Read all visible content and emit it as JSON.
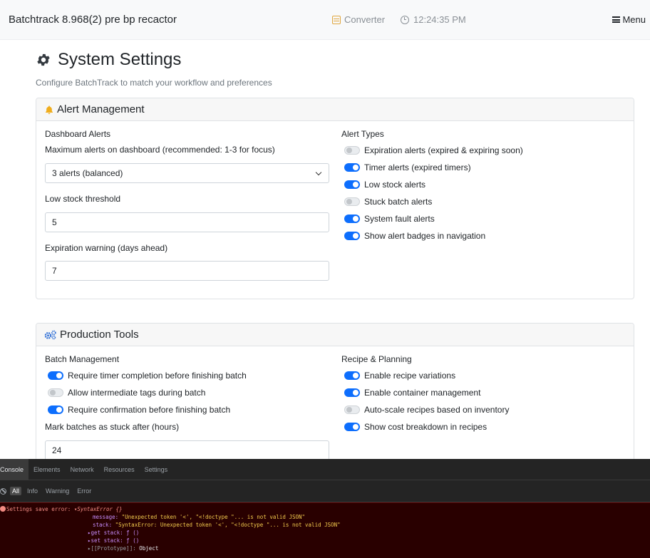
{
  "navbar": {
    "brand": "Batchtrack 8.968(2) pre bp recactor",
    "converter": "Converter",
    "time": "12:24:35 PM",
    "menu": "Menu"
  },
  "page": {
    "title": "System Settings",
    "subtitle": "Configure BatchTrack to match your workflow and preferences"
  },
  "alert_card": {
    "title": "Alert Management",
    "dashboard_heading": "Dashboard Alerts",
    "max_alerts_label": "Maximum alerts on dashboard (recommended: 1-3 for focus)",
    "max_alerts_value": "3 alerts (balanced)",
    "low_stock_label": "Low stock threshold",
    "low_stock_value": "5",
    "expiration_label": "Expiration warning (days ahead)",
    "expiration_value": "7",
    "types_heading": "Alert Types",
    "toggles": [
      {
        "label": "Expiration alerts (expired & expiring soon)",
        "on": false
      },
      {
        "label": "Timer alerts (expired timers)",
        "on": true
      },
      {
        "label": "Low stock alerts",
        "on": true
      },
      {
        "label": "Stuck batch alerts",
        "on": false
      },
      {
        "label": "System fault alerts",
        "on": true
      },
      {
        "label": "Show alert badges in navigation",
        "on": true
      }
    ]
  },
  "production_card": {
    "title": "Production Tools",
    "batch_heading": "Batch Management",
    "batch_toggles": [
      {
        "label": "Require timer completion before finishing batch",
        "on": true
      },
      {
        "label": "Allow intermediate tags during batch",
        "on": false
      },
      {
        "label": "Require confirmation before finishing batch",
        "on": true
      }
    ],
    "stuck_label": "Mark batches as stuck after (hours)",
    "stuck_value": "24",
    "recipe_heading": "Recipe & Planning",
    "recipe_toggles": [
      {
        "label": "Enable recipe variations",
        "on": true
      },
      {
        "label": "Enable container management",
        "on": true
      },
      {
        "label": "Auto-scale recipes based on inventory",
        "on": false
      },
      {
        "label": "Show cost breakdown in recipes",
        "on": true
      }
    ]
  },
  "devtools": {
    "tabs": [
      "Console",
      "Elements",
      "Network",
      "Resources",
      "Settings"
    ],
    "filters": [
      "All",
      "Info",
      "Warning",
      "Error"
    ],
    "log": {
      "prefix": "Settings save error:",
      "arrow": "▾",
      "error_type": "SyntaxError {}",
      "message_key": "message:",
      "message_val": "\"Unexpected token '<', \"<!doctype \"... is not valid JSON\"",
      "stack_key": "stack:",
      "stack_val": "\"SyntaxError: Unexpected token '<', \"<!doctype \"... is not valid JSON\"",
      "get_stack": "▸get stack: ƒ ()",
      "set_stack": "▸set stack: ƒ ()",
      "proto_key": "▸[[Prototype]]:",
      "proto_val": "Object"
    }
  },
  "colors": {
    "accent": "#0d6efd",
    "bell": "#f0ad1c",
    "gear": "#2f6fd6",
    "error": "#f28b82"
  }
}
